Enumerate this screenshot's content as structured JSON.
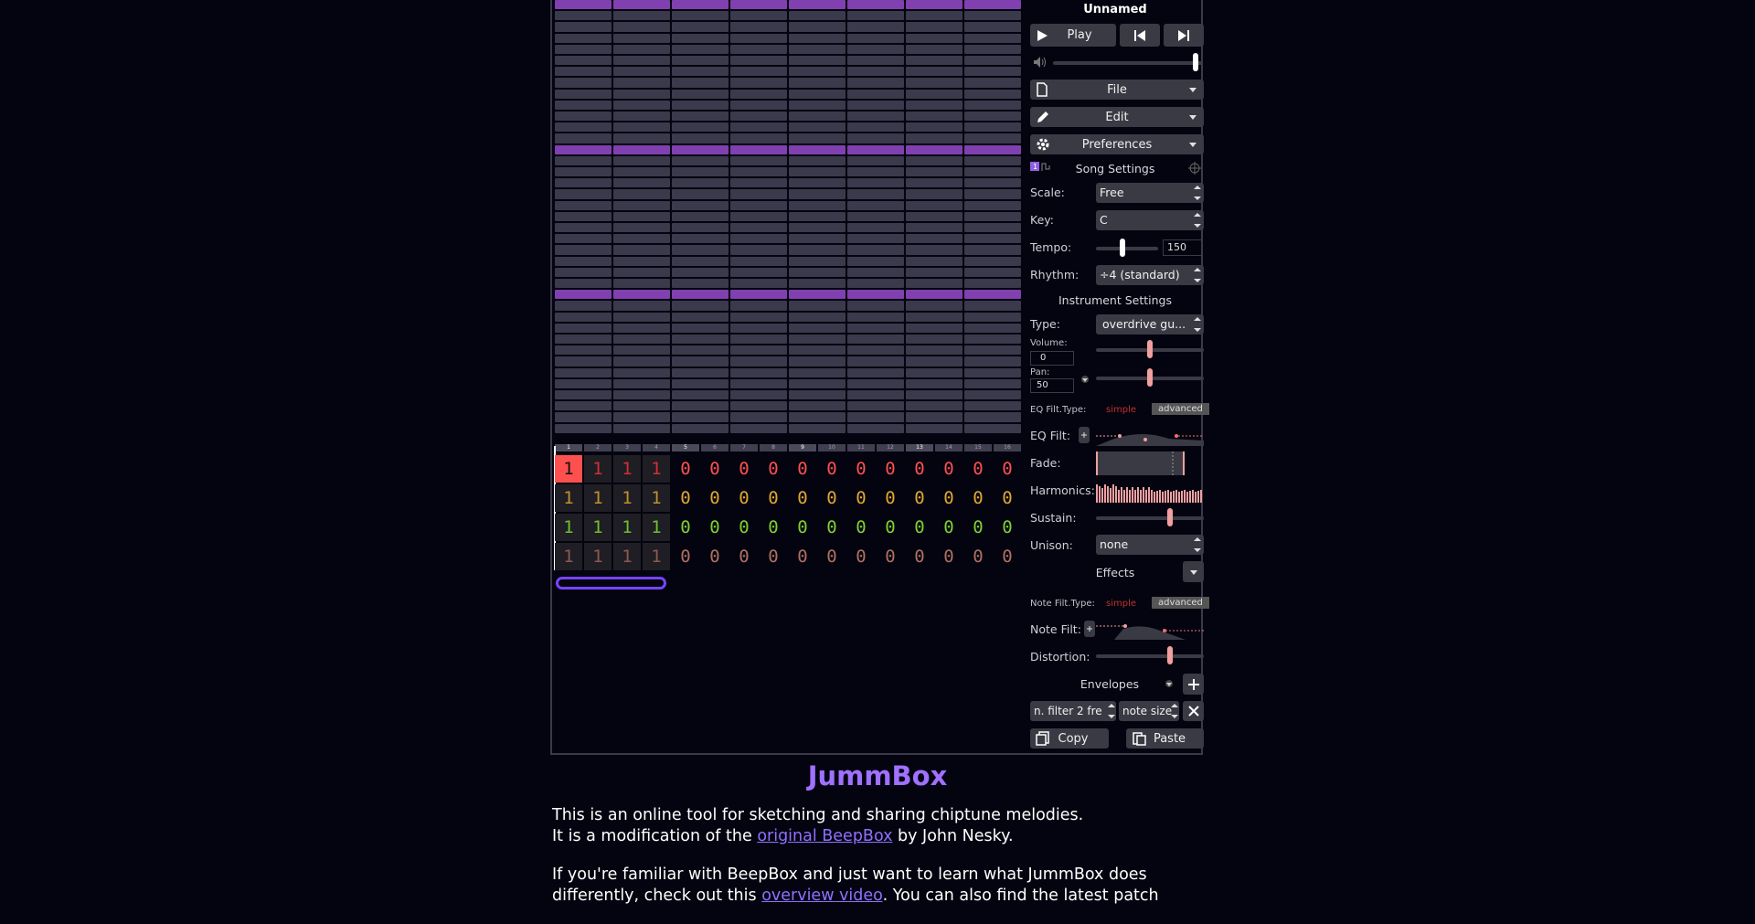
{
  "song": {
    "title": "Unnamed"
  },
  "transport": {
    "play_label": "Play",
    "prev_icon": "skip-previous-icon",
    "next_icon": "skip-next-icon",
    "volume_level": 0.97
  },
  "menus": {
    "file": "File",
    "edit": "Edit",
    "preferences": "Preferences"
  },
  "song_settings": {
    "title": "Song Settings",
    "scale_label": "Scale:",
    "scale_value": "Free",
    "key_label": "Key:",
    "key_value": "C",
    "tempo_label": "Tempo:",
    "tempo_value": "150",
    "tempo_level": 0.42,
    "rhythm_label": "Rhythm:",
    "rhythm_value": "÷4 (standard)"
  },
  "instrument_settings": {
    "title": "Instrument Settings",
    "type_label": "Type:",
    "type_value": "overdrive gu...",
    "volume_label": "Volume:",
    "volume_value": "0",
    "volume_level": 0.5,
    "pan_label": "Pan:",
    "pan_value": "50",
    "pan_level": 0.5,
    "eq_type_label": "EQ Filt.Type:",
    "eq_simple": "simple",
    "eq_advanced": "advanced",
    "eq_filt_label": "EQ Filt:",
    "fade_label": "Fade:",
    "harmonics_label": "Harmonics:",
    "sustain_label": "Sustain:",
    "sustain_level": 0.7,
    "unison_label": "Unison:",
    "unison_value": "none",
    "effects_label": "Effects",
    "note_type_label": "Note Filt.Type:",
    "note_simple": "simple",
    "note_advanced": "advanced",
    "note_filt_label": "Note Filt:",
    "distortion_label": "Distortion:",
    "distortion_level": 0.7,
    "envelopes_label": "Envelopes",
    "envelope_target": "n. filter 2 fre",
    "envelope_curve": "note size",
    "copy_label": "Copy",
    "paste_label": "Paste"
  },
  "bar_numbers": [
    "1",
    "2",
    "3",
    "4",
    "5",
    "6",
    "7",
    "8",
    "9",
    "10",
    "11",
    "12",
    "13",
    "14",
    "15",
    "16"
  ],
  "tracks": [
    {
      "color": "#ff5050",
      "dim": "#d03030",
      "values": [
        "1",
        "1",
        "1",
        "1",
        "0",
        "0",
        "0",
        "0",
        "0",
        "0",
        "0",
        "0",
        "0",
        "0",
        "0",
        "0"
      ]
    },
    {
      "color": "#e0a830",
      "dim": "#c09030",
      "values": [
        "1",
        "1",
        "1",
        "1",
        "0",
        "0",
        "0",
        "0",
        "0",
        "0",
        "0",
        "0",
        "0",
        "0",
        "0",
        "0"
      ]
    },
    {
      "color": "#80d030",
      "dim": "#70c030",
      "values": [
        "1",
        "1",
        "1",
        "1",
        "0",
        "0",
        "0",
        "0",
        "0",
        "0",
        "0",
        "0",
        "0",
        "0",
        "0",
        "0"
      ]
    },
    {
      "color": "#b07060",
      "dim": "#905850",
      "values": [
        "1",
        "1",
        "1",
        "1",
        "0",
        "0",
        "0",
        "0",
        "0",
        "0",
        "0",
        "0",
        "0",
        "0",
        "0",
        "0"
      ]
    }
  ],
  "about": {
    "heading": "JummBox",
    "line1": "This is an online tool for sketching and sharing chiptune melodies.",
    "line2_pre": "It is a modification of the ",
    "line2_link": "original BeepBox",
    "line2_post": " by John Nesky.",
    "line3": "If you're familiar with BeepBox and just want to learn what JummBox does",
    "line4_pre": "differently, check out this ",
    "line4_link": "overview video",
    "line4_post": ". You can also find the latest patch"
  },
  "colors": {
    "accent": "#9070ff",
    "pattern_row": "#3a3a4c",
    "octave_row": "#8040b0",
    "slider_knob": "#f0a0a0"
  }
}
